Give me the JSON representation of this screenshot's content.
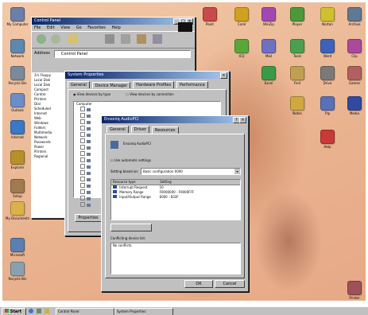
{
  "desktop": {
    "icons_left": [
      {
        "label": "My Computer",
        "color": "#6b7fa8"
      },
      {
        "label": "Network",
        "color": "#5d88b0"
      },
      {
        "label": "Recycle Bin",
        "color": "#7a8a9a"
      },
      {
        "label": "Outlook",
        "color": "#6c8ec7"
      },
      {
        "label": "Internet",
        "color": "#3a78c8"
      },
      {
        "label": "Explorer",
        "color": "#b8902a"
      },
      {
        "label": "Setup",
        "color": "#a07a50"
      },
      {
        "label": "My Documents",
        "color": "#d9b24a"
      },
      {
        "label": "Microsoft",
        "color": "#5a7fb0"
      },
      {
        "label": "Recycle Bin",
        "color": "#8aa0b0"
      }
    ],
    "icons_right": [
      {
        "label": "Paint",
        "color": "#c84a4a"
      },
      {
        "label": "Corel",
        "color": "#d0a020"
      },
      {
        "label": "WinZip",
        "color": "#a04ab0"
      },
      {
        "label": "Player",
        "color": "#4a9a3a"
      },
      {
        "label": "Norton",
        "color": "#d0c030"
      },
      {
        "label": "Archive",
        "color": "#607890"
      },
      {
        "label": "ICQ",
        "color": "#58a838"
      },
      {
        "label": "Mail",
        "color": "#7070c0"
      },
      {
        "label": "Tools",
        "color": "#4aa050"
      },
      {
        "label": "Word",
        "color": "#3d62b8"
      },
      {
        "label": "Clip",
        "color": "#aa4a9a"
      },
      {
        "label": "Excel",
        "color": "#3a9a48"
      },
      {
        "label": "Find",
        "color": "#c0a050"
      },
      {
        "label": "Drive",
        "color": "#7a7a7a"
      },
      {
        "label": "Games",
        "color": "#b06060"
      },
      {
        "label": "Notes",
        "color": "#d0a840"
      },
      {
        "label": "Ftp",
        "color": "#5a70b8"
      },
      {
        "label": "Media",
        "color": "#304aa0"
      },
      {
        "label": "Help",
        "color": "#c83a3a"
      },
      {
        "label": "Printer",
        "color": "#a05058"
      }
    ]
  },
  "control_panel": {
    "title": "Control Panel",
    "menu": [
      "File",
      "Edit",
      "View",
      "Go",
      "Favorites",
      "Help"
    ],
    "address_label": "Address",
    "address_value": "Control Panel"
  },
  "explorer_tree": {
    "items": [
      "3½ Floppy",
      "Local Disk",
      "Local Disk",
      "Compact",
      "Control",
      "Printers",
      "Dial",
      "Scheduled",
      "Internet",
      "Web",
      "Windows",
      "Folders",
      "Multimedia",
      "Network",
      "Passwords",
      "Power",
      "Printers",
      "Regional"
    ]
  },
  "system_properties": {
    "title": "System Properties",
    "tabs": [
      "General",
      "Device Manager",
      "Hardware Profiles",
      "Performance"
    ],
    "radio_type": "View devices by type",
    "radio_connection": "View devices by connection",
    "root_label": "Computer",
    "properties_button": "Properties"
  },
  "device_props": {
    "title": "Ensoniq AudioPCI",
    "tabs": [
      "General",
      "Driver",
      "Resources"
    ],
    "device_name": "Ensoniq AudioPCI",
    "auto_settings": "Use automatic settings",
    "setting_label": "Setting based on:",
    "setting_value": "Basic configuration 0000",
    "col_type": "Resource type",
    "col_setting": "Setting",
    "resources": [
      {
        "type": "Interrupt Request",
        "setting": "10"
      },
      {
        "type": "Memory Range",
        "setting": "F0000000 - F0000FFF"
      },
      {
        "type": "Input/Output Range",
        "setting": "E000 - E03F"
      }
    ],
    "conflict_label": "Conflicting device list:",
    "conflict_value": "No conflicts.",
    "ok": "OK",
    "cancel": "Cancel"
  },
  "taskbar": {
    "start": "Start",
    "tasks": [
      "Control Panel",
      "System Properties"
    ]
  }
}
